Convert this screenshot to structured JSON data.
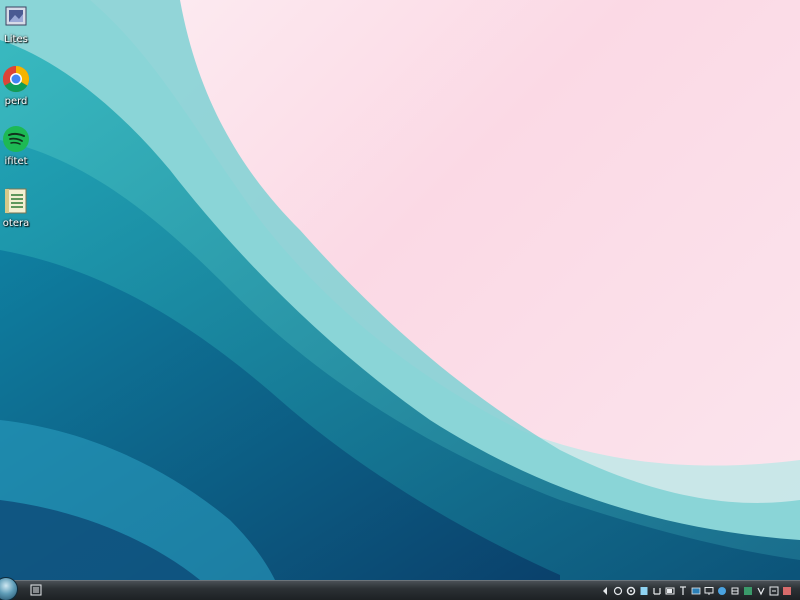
{
  "desktop": {
    "icons": [
      {
        "label": "Lites",
        "icon": "folder-image-icon"
      },
      {
        "label": "perd",
        "icon": "chrome-icon"
      },
      {
        "label": "ifitet",
        "icon": "spotify-icon"
      },
      {
        "label": "otera",
        "icon": "notepad-icon"
      }
    ]
  },
  "taskbar": {
    "start_icon": "start-orb-icon",
    "tray_icons": [
      "chevron-left-icon",
      "network-icon",
      "settings-icon",
      "app-icon",
      "sound-icon",
      "battery-icon",
      "app-icon",
      "app-icon",
      "display-icon",
      "globe-icon",
      "app-icon",
      "app-icon",
      "app-icon",
      "app-icon",
      "app-icon"
    ]
  },
  "colors": {
    "teal_dark": "#0c5f82",
    "teal": "#1aa3b3",
    "teal_light": "#7fd1d3",
    "pink": "#fbd9e5"
  }
}
